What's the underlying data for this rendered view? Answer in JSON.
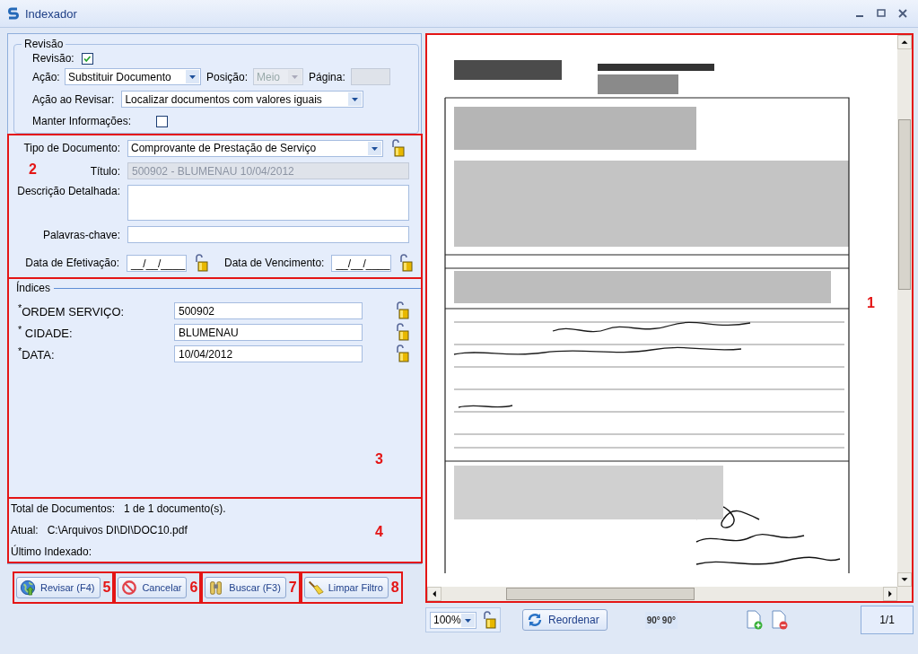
{
  "window": {
    "title": "Indexador"
  },
  "revisao": {
    "legend": "Revisão",
    "revisao": {
      "label": "Revisão:",
      "checked": true
    },
    "acao": {
      "label": "Ação:",
      "value": "Substituir Documento"
    },
    "posicao": {
      "label": "Posição:",
      "value": "Meio",
      "disabled": true
    },
    "pagina": {
      "label": "Página:",
      "disabled": true
    },
    "acao_ao_revisar": {
      "label": "Ação ao Revisar:",
      "value": "Localizar documentos com valores iguais"
    },
    "manter_informacoes": {
      "label": "Manter Informações:",
      "checked": false
    }
  },
  "documento": {
    "tipo": {
      "label": "Tipo de Documento:",
      "value": "Comprovante de Prestação de Serviço"
    },
    "titulo": {
      "label": "Título:",
      "value": "500902 - BLUMENAU 10/04/2012",
      "disabled": true
    },
    "descricao": {
      "label": "Descrição Detalhada:"
    },
    "palavras_chave": {
      "label": "Palavras-chave:"
    },
    "data_efetivacao": {
      "label": "Data de Efetivação:",
      "value": "__/__/____"
    },
    "data_vencimento": {
      "label": "Data de Vencimento:",
      "value": "__/__/____"
    }
  },
  "indices": {
    "legend": "Índices",
    "fields": [
      {
        "label": "$^{*}$ORDEM SERVIÇO:",
        "value": "500902"
      },
      {
        "label": "$^{*}$ CIDADE:",
        "value": "BLUMENAU"
      },
      {
        "label": "$^{*}$DATA:",
        "value": "10/04/2012"
      }
    ]
  },
  "info": [
    {
      "label": "Total de Documentos:",
      "value": "1 de 1 documento(s)."
    },
    {
      "label": "Atual:",
      "value": "C:\\Arquivos DI\\DI\\DOC10.pdf"
    },
    {
      "label": "Último Indexado:"
    }
  ],
  "buttons": [
    {
      "label": "Revisar (F4)",
      "kind": "globe",
      "callout": "5"
    },
    {
      "label": "Cancelar",
      "kind": "cancel",
      "callout": "6"
    },
    {
      "label": "Buscar (F3)",
      "kind": "binoculars",
      "callout": "7"
    },
    {
      "label": "Limpar Filtro",
      "kind": "broom",
      "callout": "8"
    }
  ],
  "viewer": {
    "callout": "1",
    "zoom": "100%",
    "reorder": "Reordenar",
    "rotate_left": "90°",
    "rotate_right": "90°",
    "page": "1/1"
  },
  "callouts": {
    "documento": "2",
    "indices": "3",
    "info": "4"
  }
}
